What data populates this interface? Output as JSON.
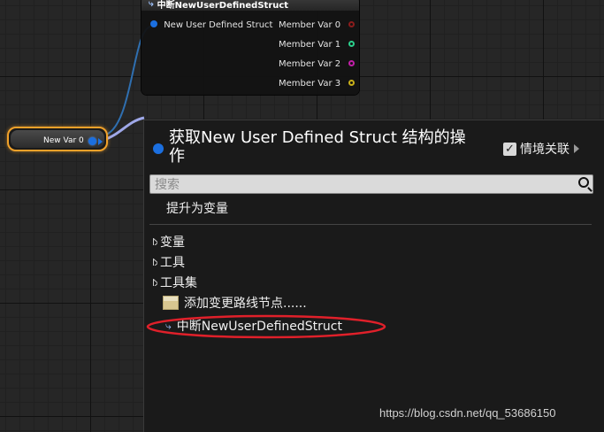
{
  "break_node": {
    "title": "中断NewUserDefinedStruct",
    "input_pin": "New User Defined Struct",
    "members": [
      {
        "label": "Member Var 0",
        "color": "#8a1c1c"
      },
      {
        "label": "Member Var 1",
        "color": "#2bcf8b"
      },
      {
        "label": "Member Var 2",
        "color": "#c21fa8"
      },
      {
        "label": "Member Var 3",
        "color": "#c9b01a"
      }
    ]
  },
  "var_node": {
    "label": "New Var 0",
    "accent": "#f0a12a"
  },
  "menu": {
    "title": "获取New User Defined Struct 结构的操作",
    "context_label": "情境关联",
    "search_placeholder": "搜索",
    "promote": "提升为变量",
    "categories": [
      "变量",
      "工具",
      "工具集"
    ],
    "reroute": "添加变更路线节点......",
    "break_action": "中断NewUserDefinedStruct"
  },
  "watermark": "https://blog.csdn.net/qq_53686150"
}
